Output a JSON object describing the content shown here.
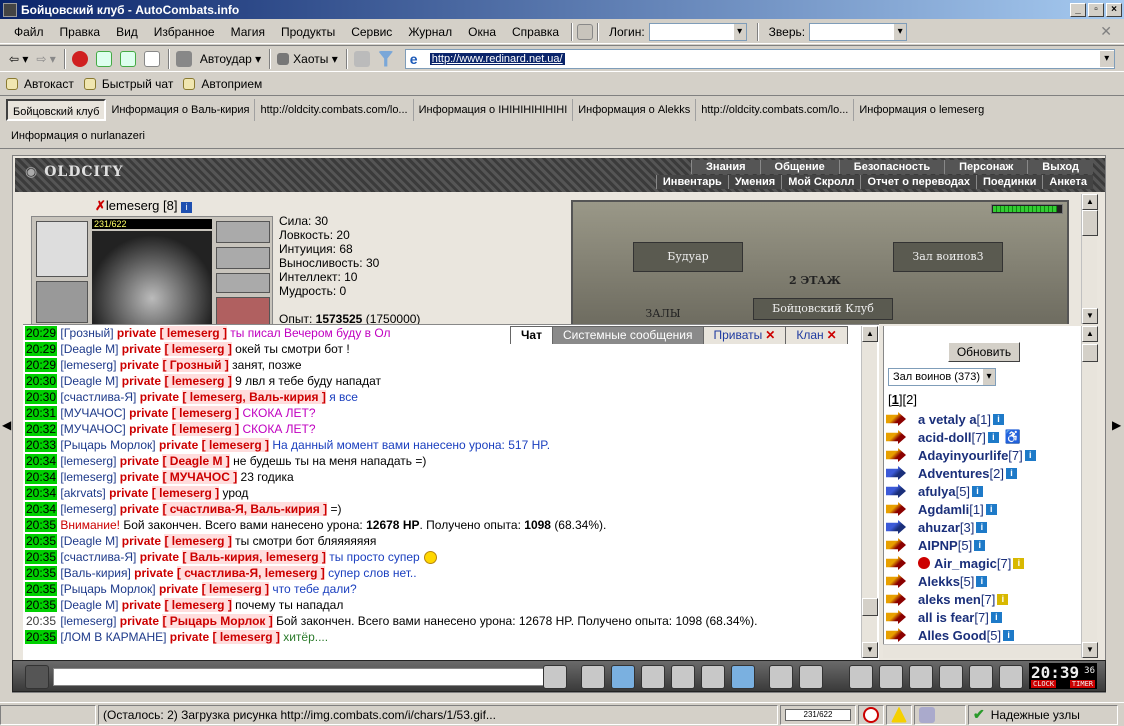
{
  "window": {
    "title": "Бойцовский клуб - AutoCombats.info"
  },
  "menu": {
    "items": [
      "Файл",
      "Правка",
      "Вид",
      "Избранное",
      "Магия",
      "Продукты",
      "Сервис",
      "Журнал",
      "Окна",
      "Справка"
    ],
    "login_label": "Логин:",
    "pet_label": "Зверь:"
  },
  "toolbar": {
    "autoudar": "Автоудар",
    "haoty": "Хаоты",
    "url": "http://www.redinard.net.ua/"
  },
  "links": [
    "Автокаст",
    "Быстрый чат",
    "Автоприем"
  ],
  "tabs": {
    "row1": [
      "Бойцовский клуб",
      "Информация о Валь-кирия",
      "http://oldcity.combats.com/lo...",
      "Информация о IHIHIHIHIHIHI",
      "Информация о Alekks",
      "http://oldcity.combats.com/lo...",
      "Информация о lemeserg"
    ],
    "row2": [
      "Информация о nurlanazeri"
    ]
  },
  "site": {
    "logo": "OLDCITY",
    "nav_top": [
      "Знания",
      "Общение",
      "Безопасность",
      "Персонаж",
      "Выход"
    ],
    "nav_bottom": [
      "Инвентарь",
      "Умения",
      "Мой Скролл",
      "Отчет о переводах",
      "Поединки",
      "Анкета"
    ]
  },
  "character": {
    "name": "lemeserg",
    "level": "[8]",
    "hp": "231/622",
    "stats": [
      "Сила: 30",
      "Ловкость: 20",
      "Интуиция: 68",
      "Выносливость: 30",
      "Интеллект: 10",
      "Мудрость: 0"
    ],
    "exp_label": "Опыт:",
    "exp_value": "1573525",
    "exp_next": "(1750000)"
  },
  "map": {
    "room_left": "Будуар",
    "room_right": "Зал воинов3",
    "floor": "2 ЭТАЖ",
    "room_bottom": "Бойцовский Клуб",
    "room_halls": "ЗАЛЫ"
  },
  "chat_tabs": [
    "Чат",
    "Системные сообщения",
    "Приваты",
    "Клан"
  ],
  "chat": [
    {
      "ts": "20:29",
      "from": "[Грозный]",
      "priv": "private",
      "to": "[ lemeserg ]",
      "msg": "ты писал Вечером буду в Ол",
      "cls": "mag"
    },
    {
      "ts": "20:29",
      "from": "[Deagle M]",
      "priv": "private",
      "to": "[ lemeserg ]",
      "msg": "окей ты смотри бот !",
      "cls": ""
    },
    {
      "ts": "20:29",
      "from": "[lemeserg]",
      "priv": "private",
      "to": "[ Грозный ]",
      "msg": "занят, позже",
      "cls": ""
    },
    {
      "ts": "20:30",
      "from": "[Deagle M]",
      "priv": "private",
      "to": "[ lemeserg ]",
      "msg": "9 лвл я тебе буду нападат",
      "cls": ""
    },
    {
      "ts": "20:30",
      "from": "[счастлива-Я]",
      "priv": "private",
      "to": "[ lemeserg, Валь-кирия ]",
      "msg": "я все",
      "cls": "blue"
    },
    {
      "ts": "20:31",
      "from": "[МУЧАЧОС]",
      "priv": "private",
      "to": "[ lemeserg ]",
      "msg": "СКОКА ЛЕТ?",
      "cls": "mag"
    },
    {
      "ts": "20:32",
      "from": "[МУЧАЧОС]",
      "priv": "private",
      "to": "[ lemeserg ]",
      "msg": "СКОКА ЛЕТ?",
      "cls": "mag"
    },
    {
      "ts": "20:33",
      "from": "[Рыцарь Морлок]",
      "priv": "private",
      "to": "[ lemeserg ]",
      "msg": "На данный момент вами нанесено урона: 517 HP.",
      "cls": "blue"
    },
    {
      "ts": "20:34",
      "from": "[lemeserg]",
      "priv": "private",
      "to": "[ Deagle M ]",
      "msg": "не будешь ты на меня нападать =)",
      "cls": ""
    },
    {
      "ts": "20:34",
      "from": "[lemeserg]",
      "priv": "private",
      "to": "[ МУЧАЧОС ]",
      "msg": "23 годика",
      "cls": ""
    },
    {
      "ts": "20:34",
      "from": "[akrvats]",
      "priv": "private",
      "to": "[ lemeserg ]",
      "msg": "урод",
      "cls": ""
    },
    {
      "ts": "20:34",
      "from": "[lemeserg]",
      "priv": "private",
      "to": "[ счастлива-Я, Валь-кирия ]",
      "msg": "=)",
      "cls": ""
    }
  ],
  "chat_system_1": {
    "ts": "20:35",
    "attn": "Внимание!",
    "pre": "Бой закончен. Всего вами нанесено урона:",
    "dmg": "12678 HP",
    "mid": ". Получено опыта:",
    "exp": "1098",
    "post": "(68.34%)."
  },
  "chat2": [
    {
      "ts": "20:35",
      "from": "[Deagle M]",
      "priv": "private",
      "to": "[ lemeserg ]",
      "msg": "ты смотри бот бляяяяяяя",
      "cls": ""
    },
    {
      "ts": "20:35",
      "from": "[счастлива-Я]",
      "priv": "private",
      "to": "[ Валь-кирия, lemeserg ]",
      "msg": "ты просто супер",
      "cls": "blue"
    },
    {
      "ts": "20:35",
      "from": "[Валь-кирия]",
      "priv": "private",
      "to": "[ счастлива-Я, lemeserg ]",
      "msg": "супер слов нет..",
      "cls": "blue"
    },
    {
      "ts": "20:35",
      "from": "[Рыцарь Морлок]",
      "priv": "private",
      "to": "[ lemeserg ]",
      "msg": "что тебе дали?",
      "cls": "blue"
    },
    {
      "ts": "20:35",
      "from": "[Deagle M]",
      "priv": "private",
      "to": "[ lemeserg ]",
      "msg": "почему ты нападал",
      "cls": ""
    }
  ],
  "chat_wrap": {
    "ts": "20:35",
    "from": "[lemeserg]",
    "priv": "private",
    "to": "[ Рыцарь Морлок ]",
    "msg": "Бой закончен. Всего вами нанесено урона: 12678 HP. Получено опыта: 1098 (68.34%)."
  },
  "chat_last": {
    "ts": "20:35",
    "from": "[ЛОМ В КАРМАНЕ]",
    "priv": "private",
    "to": "[ lemeserg ]",
    "msg": "хитёр...."
  },
  "room_panel": {
    "refresh": "Обновить",
    "room_select": "Зал воинов (373)",
    "page1": "1",
    "page2": "2",
    "users": [
      {
        "name": "a vetaly a",
        "lvl": "[1]"
      },
      {
        "name": "acid-doll",
        "lvl": "[7]"
      },
      {
        "name": "Adayinyourlife",
        "lvl": "[7]"
      },
      {
        "name": "Adventures",
        "lvl": "[2]"
      },
      {
        "name": "afulya",
        "lvl": "[5]"
      },
      {
        "name": "Agdamli",
        "lvl": "[1]"
      },
      {
        "name": "ahuzar",
        "lvl": "[3]"
      },
      {
        "name": "AIPNP",
        "lvl": "[5]"
      },
      {
        "name": "Air_magic",
        "lvl": "[7]"
      },
      {
        "name": "Alekks",
        "lvl": "[5]"
      },
      {
        "name": "aleks men",
        "lvl": "[7]"
      },
      {
        "name": "all is fear",
        "lvl": "[7]"
      },
      {
        "name": "Alles Good",
        "lvl": "[5]"
      }
    ]
  },
  "clock": {
    "time": "20:39",
    "sec": "36",
    "label1": "CLOCK",
    "label2": "TIMER"
  },
  "status": {
    "text": "(Осталось: 2) Загрузка рисунка http://img.combats.com/i/chars/1/53.gif...",
    "hp": "231/622",
    "zone": "Надежные узлы"
  }
}
